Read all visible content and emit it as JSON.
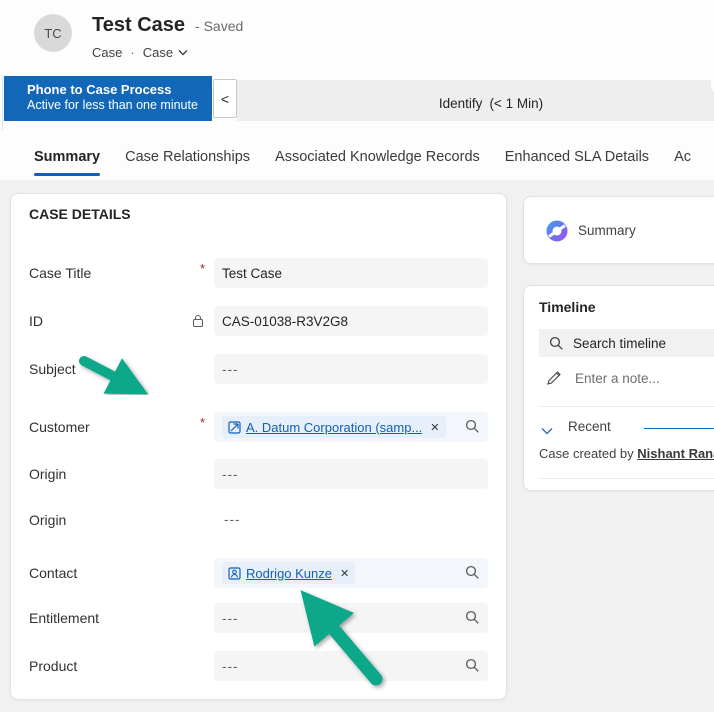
{
  "header": {
    "avatar_initials": "TC",
    "title": "Test Case",
    "status": "- Saved",
    "entity": "Case",
    "separator": "·",
    "form_name": "Case"
  },
  "process": {
    "name": "Phone to Case Process",
    "active_for": "Active for less than one minute",
    "stage": "Identify",
    "stage_duration": "(< 1 Min)"
  },
  "tabs": [
    {
      "label": "Summary",
      "active": true
    },
    {
      "label": "Case Relationships",
      "active": false
    },
    {
      "label": "Associated Knowledge Records",
      "active": false
    },
    {
      "label": "Enhanced SLA Details",
      "active": false
    },
    {
      "label": "Ac",
      "active": false
    }
  ],
  "case_details": {
    "title": "CASE DETAILS",
    "required_marker": "*",
    "fields": [
      {
        "label": "Case Title",
        "value": "Test Case",
        "required": true,
        "type": "text"
      },
      {
        "label": "ID",
        "value": "CAS-01038-R3V2G8",
        "locked": true,
        "type": "text"
      },
      {
        "label": "Subject",
        "value": "---",
        "type": "text"
      },
      {
        "label": "Customer",
        "value": "A. Datum Corporation (samp...",
        "required": true,
        "type": "lookup",
        "icon": "account-icon"
      },
      {
        "label": "Origin",
        "value": "---",
        "type": "text"
      },
      {
        "label": "Origin",
        "value": "---",
        "type": "readonly"
      },
      {
        "label": "Contact",
        "value": "Rodrigo Kunze",
        "type": "lookup",
        "icon": "contact-icon"
      },
      {
        "label": "Entitlement",
        "value": "---",
        "type": "lookup-empty"
      },
      {
        "label": "Product",
        "value": "---",
        "type": "lookup-empty"
      }
    ]
  },
  "side_panel": {
    "summary_card": {
      "label": "Summary",
      "icon": "copilot-icon"
    },
    "timeline": {
      "title": "Timeline",
      "search_placeholder": "Search timeline",
      "note_placeholder": "Enter a note...",
      "recent_label": "Recent",
      "recent_entry_prefix": "Case created by ",
      "recent_entry_user": "Nishant Rana"
    }
  },
  "icons": {
    "close_glyph": "✕",
    "collapse_glyph": "<"
  },
  "colors": {
    "process_blue": "#1267b8",
    "accent_blue": "#1160b7",
    "link_blue": "#1160b7",
    "arrow_teal": "#10a78a",
    "required_red": "#a4262c"
  }
}
